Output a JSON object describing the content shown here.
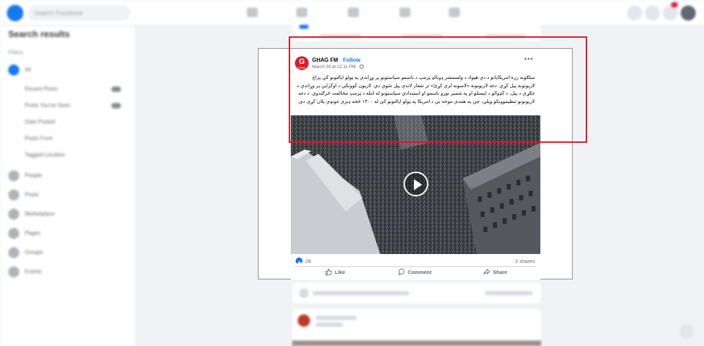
{
  "header": {
    "search_placeholder": "Search Facebook"
  },
  "sidebar": {
    "title": "Search results",
    "filters_label": "Filters",
    "items": [
      {
        "label": "All"
      },
      {
        "label": "Recent Posts"
      },
      {
        "label": "Posts You've Seen"
      },
      {
        "label": "Date Posted"
      },
      {
        "label": "Posts From"
      },
      {
        "label": "Tagged Location"
      },
      {
        "label": "People"
      },
      {
        "label": "Posts"
      },
      {
        "label": "Marketplace"
      },
      {
        "label": "Pages"
      },
      {
        "label": "Groups"
      },
      {
        "label": "Events"
      }
    ]
  },
  "post": {
    "page_name": "GHAG FM",
    "separator": "·",
    "follow_label": "Follow",
    "timestamp": "March 29 at 12:11 PM ·",
    "avatar_letter": "G",
    "avatar_small": "GHAG",
    "more_label": "•••",
    "text": "سلګونه زره امریکایانو د دې هیواد د ولسمشر ډونالډ ټرمپ د ناسمو سیاستونو پر وړاندې په ټولو ایالتونو کې پراخ لاریونونه پیل کړي. دغه لاریونونه «لاسونه لرې کړئ» تر شعار لاندې پیل شوي دي. لاریون کوونکي د اوکراین پر وړاندې د جګړې د پیل، د کډوالو د ایستلو او په شمیر نورو ناسمو او استبدادي سیاستونو له امله د ټرمپ مخالفت څرګندوي. د دغه لاریونونو تنظیموونکو ویلي، چې په همدې موخه یې د امریکا په ټولو ایالتونو کې له ۱۴۰۰ څخه ډېرې غونډې پلان کړې دي.",
    "like_count": "28",
    "shares": "2 shares",
    "actions": {
      "like": "Like",
      "comment": "Comment",
      "share": "Share"
    }
  },
  "colors": {
    "brand_blue": "#1877f2",
    "highlight_red": "#e0141e",
    "avatar_red": "#d71f26"
  }
}
